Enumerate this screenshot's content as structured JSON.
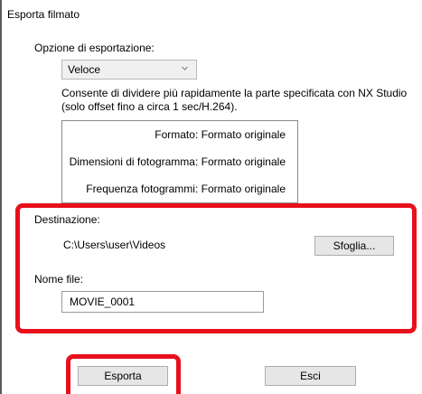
{
  "window": {
    "title": "Esporta filmato"
  },
  "export_option": {
    "label": "Opzione di esportazione:",
    "selected": "Veloce",
    "description_line1": "Consente di dividere più rapidamente la parte specificata con NX Studio",
    "description_line2": "(solo offset fino a circa 1 sec/H.264)."
  },
  "format_info": {
    "format": "Formato: Formato originale",
    "frame_size": "Dimensioni di fotogramma: Formato originale",
    "frame_rate": "Frequenza fotogrammi: Formato originale"
  },
  "destination": {
    "label": "Destinazione:",
    "path": "C:\\Users\\user\\Videos",
    "browse_button": "Sfoglia..."
  },
  "filename": {
    "label": "Nome file:",
    "value": "MOVIE_0001"
  },
  "actions": {
    "export_button": "Esporta",
    "exit_button": "Esci"
  },
  "colors": {
    "highlight": "#e8101c",
    "button_face": "#e6e6e6"
  }
}
